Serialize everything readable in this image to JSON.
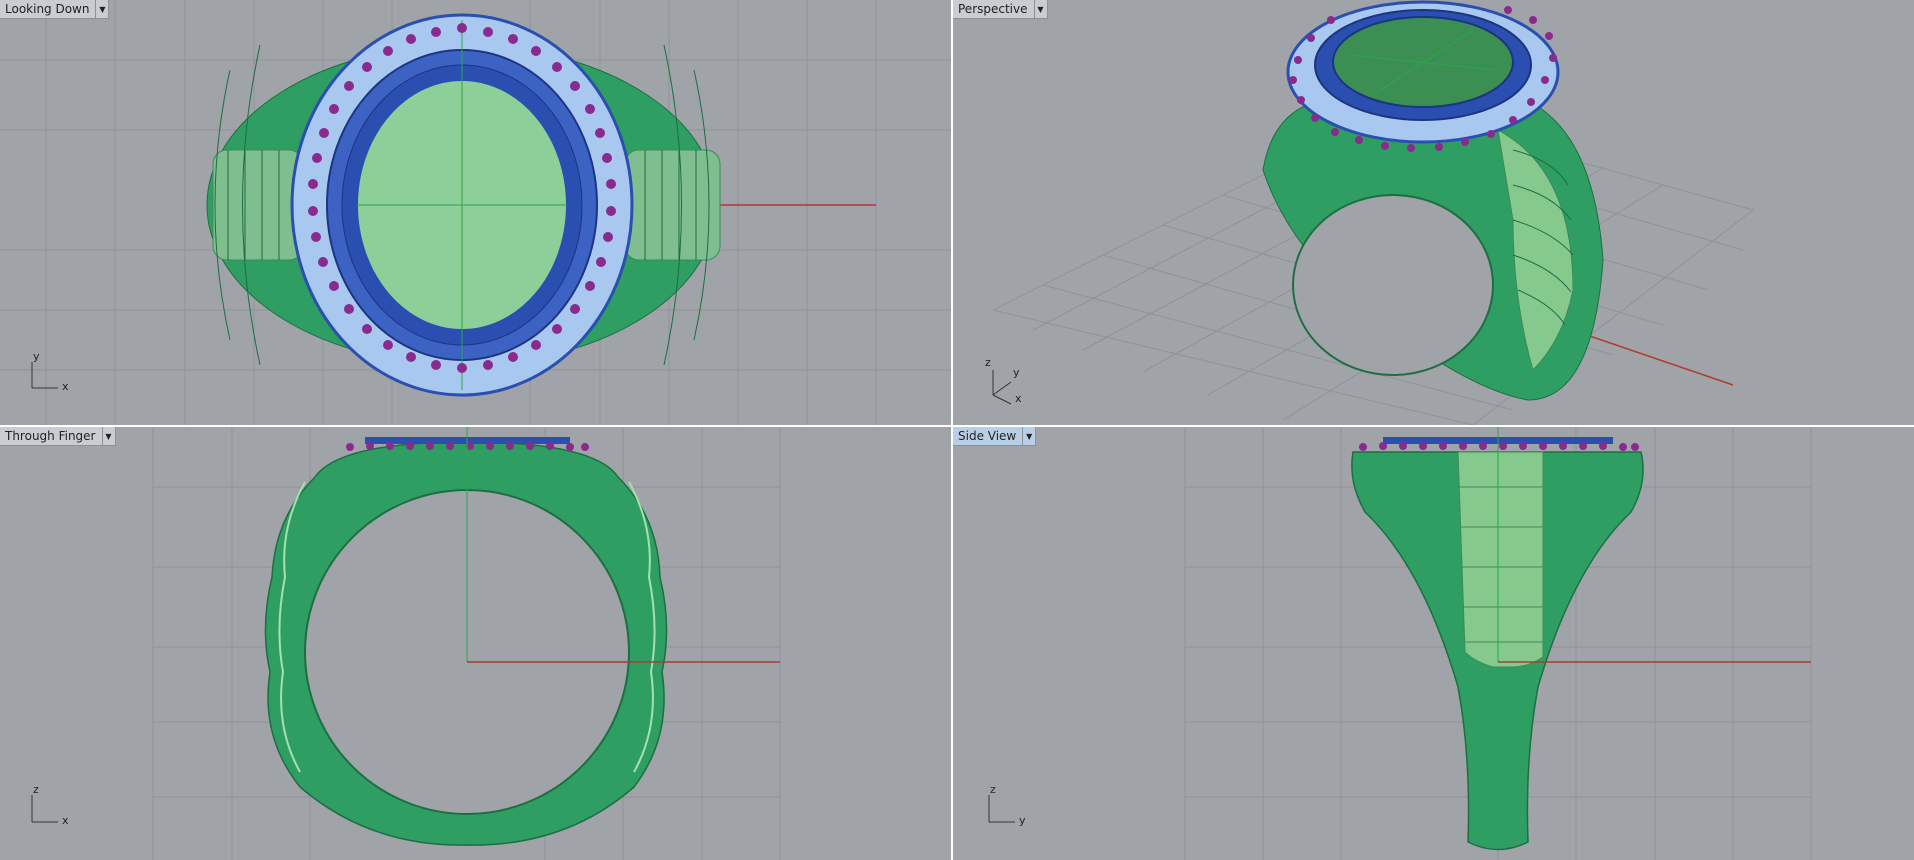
{
  "viewports": {
    "top": {
      "title": "Looking Down",
      "axis_vertical": "y",
      "axis_horizontal": "x"
    },
    "perspective": {
      "title": "Perspective",
      "axis_z": "z",
      "axis_y": "y",
      "axis_x": "x"
    },
    "front": {
      "title": "Through Finger",
      "axis_vertical": "z",
      "axis_horizontal": "x"
    },
    "right": {
      "title": "Side View",
      "axis_vertical": "z",
      "axis_horizontal": "y"
    }
  },
  "dropdown_icon": "chevron-down-icon",
  "colors": {
    "viewport_bg": "#a0a4a8",
    "grid_minor": "#8f9398",
    "grid_major": "#7e8287",
    "x_axis": "#b03a2e",
    "y_axis": "#2aa84a",
    "band_green": "#2f9e63",
    "band_light": "#7fd49a",
    "bezel_blue": "#2a4fb0",
    "stone_light_blue": "#a9c8f0",
    "prong_purple": "#8a2a8e",
    "active_title": "#b9cfe8"
  }
}
